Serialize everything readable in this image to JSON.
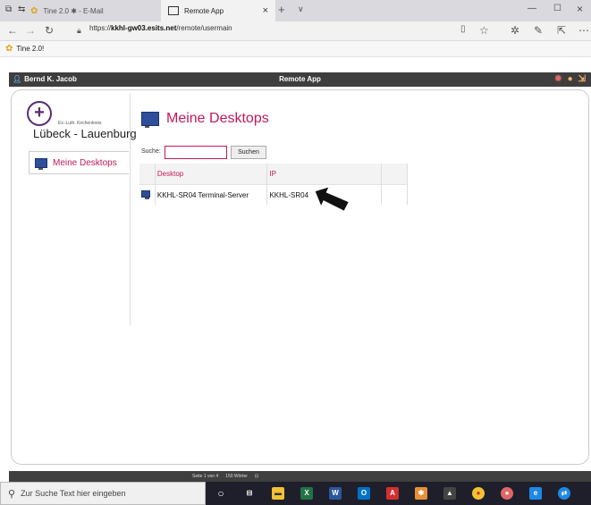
{
  "browser": {
    "tabs": [
      {
        "title": "Tine 2.0 ✱ - E-Mail"
      },
      {
        "title": "Remote App"
      }
    ],
    "url_prefix": "https://",
    "url_host": "kkhl-gw03.esits.net",
    "url_path": "/remote/usermain",
    "favorites": [
      {
        "label": "Tine 2.0!"
      }
    ]
  },
  "app": {
    "user": "Bernd K. Jacob",
    "title": "Remote App"
  },
  "logo": {
    "symbol": "+",
    "line1": "Ev.-Luth. Kirchenkreis",
    "line2": "Lübeck - Lauenburg"
  },
  "sidebar": {
    "items": [
      {
        "label": "Meine Desktops"
      }
    ]
  },
  "main": {
    "title": "Meine Desktops",
    "search_label": "Suche:",
    "search_value": "",
    "search_button": "Suchen",
    "table": {
      "headers": [
        "Desktop",
        "IP"
      ],
      "rows": [
        {
          "desktop": "KKHL-SR04 Terminal-Server",
          "ip": "KKHL-SR04"
        }
      ]
    }
  },
  "word_status": {
    "page": "Seite 1 von 4",
    "words": "150 Wörter"
  },
  "taskbar": {
    "search_placeholder": "Zur Suche Text hier eingeben"
  },
  "colors": {
    "accent": "#c2185b",
    "header_bg": "#3e3e3e",
    "taskbar_bg": "#1f1f2b"
  }
}
